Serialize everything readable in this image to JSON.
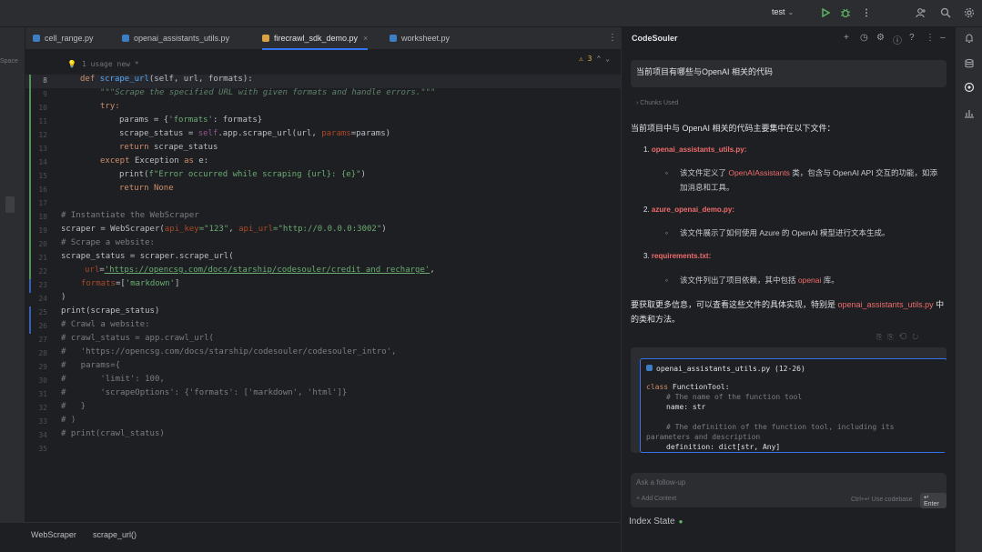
{
  "toolbar": {
    "run_config": "test",
    "icons": [
      "run-icon",
      "debug-icon",
      "more-icon",
      "add-user-icon",
      "search-icon",
      "settings-icon"
    ]
  },
  "left_strip": {
    "project_label": "Space"
  },
  "tabs": [
    {
      "label": "cell_range.py",
      "active": false
    },
    {
      "label": "openai_assistants_utils.py",
      "active": false
    },
    {
      "label": "firecrawl_sdk_demo.py",
      "active": true
    },
    {
      "label": "worksheet.py",
      "active": false
    }
  ],
  "editor": {
    "inlay_hint": "1 usage  new *",
    "warnings": "3",
    "lines": [
      {
        "n": "8"
      },
      {
        "n": "9"
      },
      {
        "n": "10"
      },
      {
        "n": "11"
      },
      {
        "n": "12"
      },
      {
        "n": "13"
      },
      {
        "n": "14"
      },
      {
        "n": "15"
      },
      {
        "n": "16"
      },
      {
        "n": "17"
      },
      {
        "n": "18"
      },
      {
        "n": "19"
      },
      {
        "n": "20"
      },
      {
        "n": "21"
      },
      {
        "n": "22"
      },
      {
        "n": "23"
      },
      {
        "n": "24"
      },
      {
        "n": "25"
      },
      {
        "n": "26"
      },
      {
        "n": "27"
      },
      {
        "n": "28"
      },
      {
        "n": "29"
      },
      {
        "n": "30"
      },
      {
        "n": "31"
      },
      {
        "n": "32"
      },
      {
        "n": "33"
      },
      {
        "n": "34"
      },
      {
        "n": "35"
      }
    ],
    "code": {
      "l8_def": "def ",
      "l8_name": "scrape_url",
      "l8_rest": "(self, url, formats):",
      "l9": "\"\"\"Scrape the specified URL with given formats and handle errors.\"\"\"",
      "l10": "try:",
      "l11_a": "params = {",
      "l11_s": "'formats'",
      "l11_b": ": formats}",
      "l12_a": "scrape_status = ",
      "l12_self": "self",
      "l12_b": ".app.scrape_url(url, ",
      "l12_p": "params",
      "l12_c": "=params)",
      "l13_k": "return ",
      "l13_b": "scrape_status",
      "l14_k": "except ",
      "l14_b": "Exception ",
      "l14_as": "as ",
      "l14_c": "e:",
      "l15_a": "print(",
      "l15_s": "f\"Error occurred while scraping {url}: {e}\"",
      "l15_b": ")",
      "l16_k": "return ",
      "l16_none": "None",
      "l18": "# Instantiate the WebScraper",
      "l19_a": "scraper = WebScraper(",
      "l19_p1": "api_key",
      "l19_s1": "=\"123\"",
      "l19_c": ", ",
      "l19_p2": "api_url",
      "l19_s2": "=\"http://0.0.0.0:3002\"",
      "l19_d": ")",
      "l20": "# Scrape a website:",
      "l21": "scrape_status = scraper.scrape_url(",
      "l22_p": "url",
      "l22_eq": "=",
      "l22_s": "'https://opencsg.com/docs/starship/codesouler/credit_and_recharge'",
      "l22_c": ",",
      "l23_p": "formats",
      "l23_b": "=[",
      "l23_s": "'markdown'",
      "l23_c": "]",
      "l24": ")",
      "l25": "print(scrape_status)",
      "l26": "# Crawl a website:",
      "l27": "# crawl_status = app.crawl_url(",
      "l28": "#   'https://opencsg.com/docs/starship/codesouler/codesouler_intro',",
      "l29": "#   params={",
      "l30": "#       'limit': 100,",
      "l31": "#       'scrapeOptions': {'formats': ['markdown', 'html']}",
      "l32": "#   }",
      "l33": "# )",
      "l34": "# print(crawl_status)"
    }
  },
  "statusbar": {
    "crumbs": [
      "WebScraper",
      "scrape_url()"
    ]
  },
  "codesouler": {
    "title": "CodeSouler",
    "question": "当前项目有哪些与OpenAI 相关的代码",
    "chunks_label": "Chunks Used",
    "answer_intro": "当前项目中与 OpenAI 相关的代码主要集中在以下文件：",
    "items": [
      {
        "num": "1.",
        "file": "openai_assistants_utils.py:",
        "desc_a": "该文件定义了 ",
        "desc_hl": "OpenAIAssistants",
        "desc_b": " 类，包含与 OpenAI API 交互的功能，如添加消息和工具。"
      },
      {
        "num": "2.",
        "file": "azure_openai_demo.py:",
        "desc_a": "该文件展示了如何使用 Azure 的 OpenAI 模型进行文本生成。",
        "desc_hl": "",
        "desc_b": ""
      },
      {
        "num": "3.",
        "file": "requirements.txt:",
        "desc_a": "该文件列出了项目依赖，其中包括 ",
        "desc_hl": "openai",
        "desc_b": " 库。"
      }
    ],
    "outro_a": "要获取更多信息，可以查看这些文件的具体实现，特别是 ",
    "outro_hl": "openai_assistants_utils.py",
    "outro_b": " 中的类和方法。",
    "code_ref": "openai_assistants_utils.py (12-26)",
    "code_lines": {
      "c1_k": "class ",
      "c1_n": "FunctionTool:",
      "c2": "# The name of the function tool",
      "c3": "name: str",
      "c4": "# The definition of the function tool, including its",
      "c5": "parameters and description",
      "c6": "definition: dict[str, Any]"
    },
    "input_placeholder": "Ask a follow-up",
    "add_context": "+ Add Context",
    "shortcut_hint": "Ctrl+↵ Use codebase",
    "enter_label": "↵ Enter",
    "index_state": "Index State"
  },
  "colors": {
    "accent": "#3574f0",
    "keyword": "#cf8e6d",
    "function": "#56a8f5",
    "string": "#6aab73",
    "comment": "#7a7e85",
    "highlight_red": "#ef6c6c",
    "ok_green": "#5fb865"
  }
}
